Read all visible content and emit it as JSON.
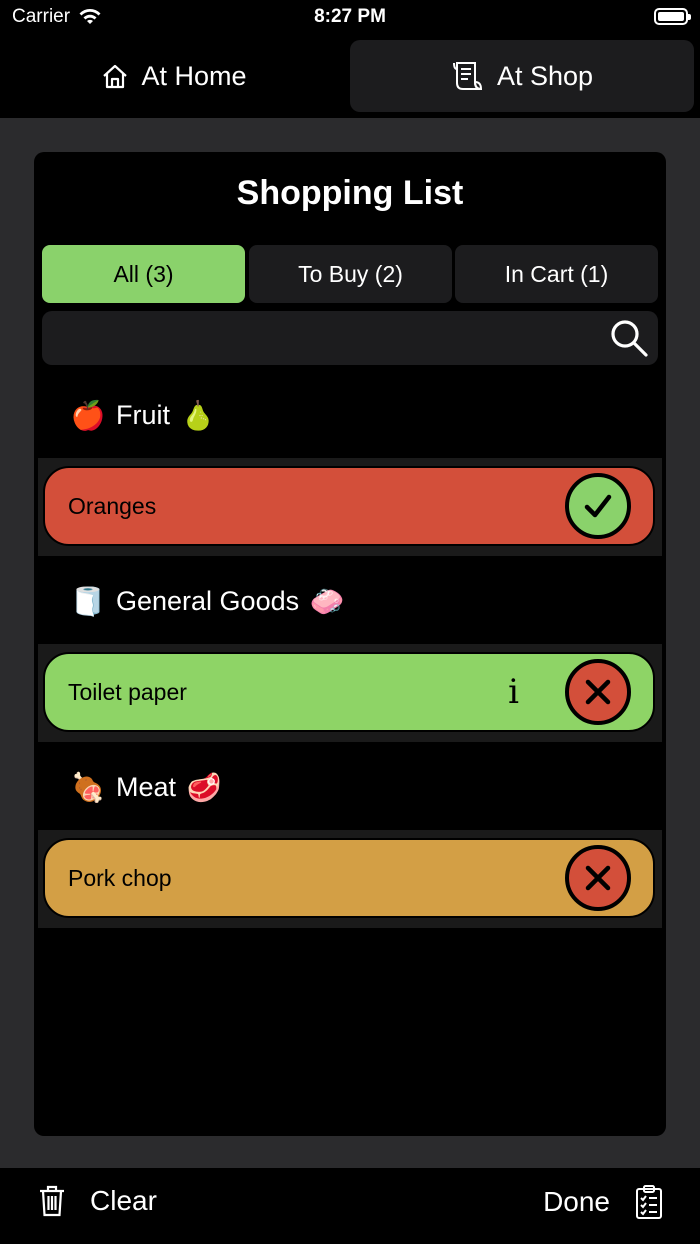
{
  "status_bar": {
    "carrier": "Carrier",
    "time": "8:27 PM"
  },
  "mode_tabs": [
    {
      "label": "At Home",
      "icon": "house-icon"
    },
    {
      "label": "At Shop",
      "icon": "receipt-icon",
      "selected": true
    }
  ],
  "list": {
    "title": "Shopping List",
    "filters": [
      {
        "label": "All (3)",
        "active": true
      },
      {
        "label": "To Buy (2)",
        "active": false
      },
      {
        "label": "In Cart (1)",
        "active": false
      }
    ],
    "search": {
      "placeholder": "",
      "icon": "magnifier-icon"
    },
    "categories": [
      {
        "name": "Fruit",
        "emoji_left": "🍎",
        "emoji_right": "🍐",
        "items": [
          {
            "name": "Oranges",
            "color": "#d34f3a",
            "action": "check",
            "action_color": "#8ad26b",
            "info": false
          }
        ]
      },
      {
        "name": "General Goods",
        "emoji_left": "🧻",
        "emoji_right": "🧼",
        "items": [
          {
            "name": "Toilet paper",
            "color": "#8ed466",
            "action": "remove",
            "action_color": "#d34f3a",
            "info": true,
            "info_glyph": "i"
          }
        ]
      },
      {
        "name": "Meat",
        "emoji_left": "🍖",
        "emoji_right": "🥩",
        "items": [
          {
            "name": "Pork chop",
            "color": "#d39f45",
            "action": "remove",
            "action_color": "#d34f3a",
            "info": false
          }
        ]
      }
    ]
  },
  "bottom_bar": {
    "clear_label": "Clear",
    "done_label": "Done"
  }
}
